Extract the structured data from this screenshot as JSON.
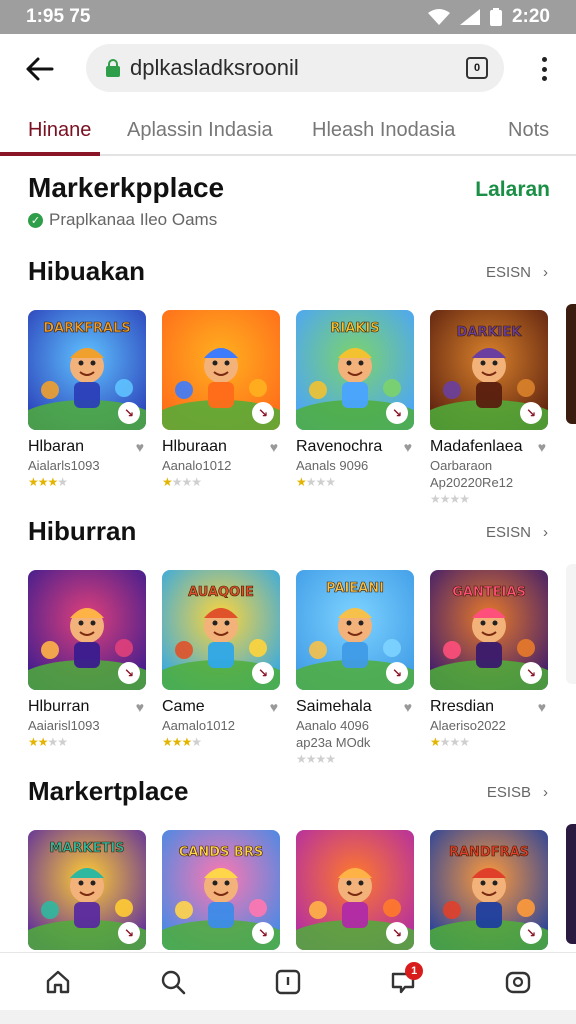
{
  "status_bar": {
    "time": "1:95 75",
    "clock": "2:20"
  },
  "browser": {
    "url": "dplkasladksroonil",
    "tab_count": "0"
  },
  "tabs": [
    {
      "label": "Hinane",
      "active": true
    },
    {
      "label": "Aplassin Indasia",
      "active": false
    },
    {
      "label": "Hleash Inodasia",
      "active": false
    },
    {
      "label": "Nots",
      "active": false
    }
  ],
  "header": {
    "title": "Markerkpplace",
    "action": "Lalaran",
    "verified_text": "Praplkanaa Ileo Oams"
  },
  "sections": [
    {
      "title": "Hibuakan",
      "see_more": "ESISN",
      "cards": [
        {
          "name": "Hlbaran",
          "sub": "Aialarls1093",
          "sub2": "",
          "rating": 3,
          "art": "DARKFRALS"
        },
        {
          "name": "Hlburaan",
          "sub": "Aanalo1012",
          "sub2": "",
          "rating": 1,
          "art": ""
        },
        {
          "name": "Ravenochra",
          "sub": "Aanals 9096",
          "sub2": "",
          "rating": 1,
          "art": "RIAKIS"
        },
        {
          "name": "Madafenlaea",
          "sub": "Oarbaraon",
          "sub2": "Ap20220Re12",
          "rating": 0,
          "art": "DARKIEK"
        }
      ]
    },
    {
      "title": "Hiburran",
      "see_more": "ESISN",
      "cards": [
        {
          "name": "Hlburran",
          "sub": "Aaiarisl1093",
          "sub2": "",
          "rating": 2,
          "art": ""
        },
        {
          "name": "Came",
          "sub": "Aamalo1012",
          "sub2": "",
          "rating": 3,
          "art": "AUAQOIE"
        },
        {
          "name": "Saimehala",
          "sub": "Aanalo 4096",
          "sub2": "ap23a MOdk",
          "rating": 0,
          "art": "PAIEANI"
        },
        {
          "name": "Rresdian",
          "sub": "Alaeriso2022",
          "sub2": "",
          "rating": 1,
          "art": "GANTEIAS"
        }
      ]
    },
    {
      "title": "Markertplace",
      "see_more": "ESISB",
      "cards": [
        {
          "name": "",
          "sub": "",
          "sub2": "",
          "rating": 0,
          "art": "MARKETIS"
        },
        {
          "name": "",
          "sub": "",
          "sub2": "",
          "rating": 0,
          "art": "CANDS BRS"
        },
        {
          "name": "",
          "sub": "",
          "sub2": "",
          "rating": 0,
          "art": ""
        },
        {
          "name": "",
          "sub": "",
          "sub2": "",
          "rating": 0,
          "art": "RANDFRAS"
        }
      ]
    }
  ],
  "bottom_nav": [
    {
      "icon": "home-icon"
    },
    {
      "icon": "search-icon"
    },
    {
      "icon": "library-icon"
    },
    {
      "icon": "notifications-icon",
      "badge": "1"
    },
    {
      "icon": "profile-icon"
    }
  ],
  "colors": {
    "accent": "#8a1526",
    "green": "#1a8f45",
    "status_bar": "#9e9e9e"
  }
}
